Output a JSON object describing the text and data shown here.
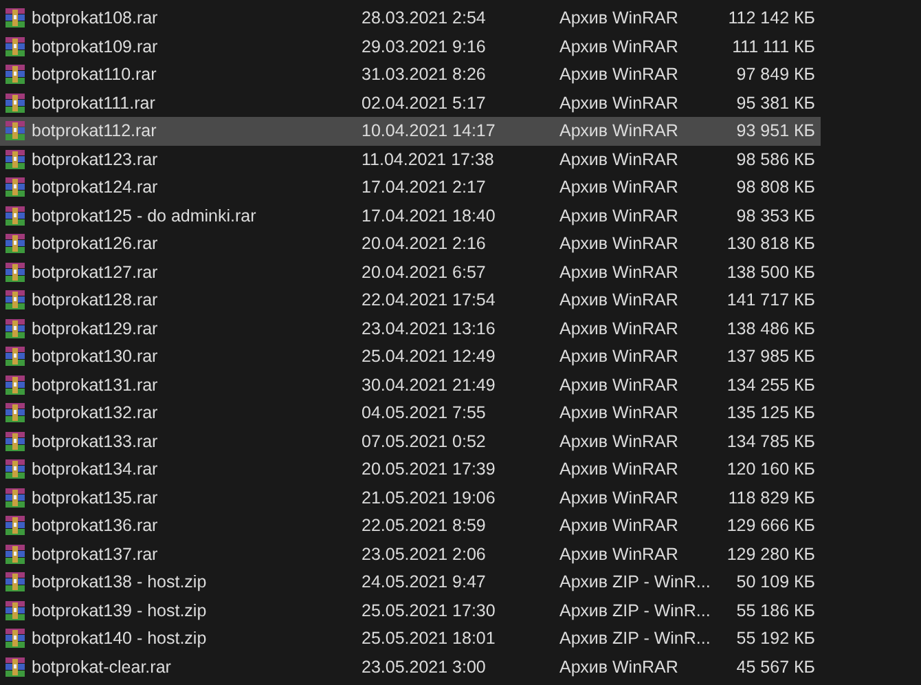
{
  "files": [
    {
      "name": "botprokat108.rar",
      "modified": "28.03.2021 2:54",
      "type": "Архив WinRAR",
      "size": "112 142 КБ",
      "selected": false
    },
    {
      "name": "botprokat109.rar",
      "modified": "29.03.2021 9:16",
      "type": "Архив WinRAR",
      "size": "111 111 КБ",
      "selected": false
    },
    {
      "name": "botprokat110.rar",
      "modified": "31.03.2021 8:26",
      "type": "Архив WinRAR",
      "size": "97 849 КБ",
      "selected": false
    },
    {
      "name": "botprokat111.rar",
      "modified": "02.04.2021 5:17",
      "type": "Архив WinRAR",
      "size": "95 381 КБ",
      "selected": false
    },
    {
      "name": "botprokat112.rar",
      "modified": "10.04.2021 14:17",
      "type": "Архив WinRAR",
      "size": "93 951 КБ",
      "selected": true
    },
    {
      "name": "botprokat123.rar",
      "modified": "11.04.2021 17:38",
      "type": "Архив WinRAR",
      "size": "98 586 КБ",
      "selected": false
    },
    {
      "name": "botprokat124.rar",
      "modified": "17.04.2021 2:17",
      "type": "Архив WinRAR",
      "size": "98 808 КБ",
      "selected": false
    },
    {
      "name": "botprokat125 - do adminki.rar",
      "modified": "17.04.2021 18:40",
      "type": "Архив WinRAR",
      "size": "98 353 КБ",
      "selected": false
    },
    {
      "name": "botprokat126.rar",
      "modified": "20.04.2021 2:16",
      "type": "Архив WinRAR",
      "size": "130 818 КБ",
      "selected": false
    },
    {
      "name": "botprokat127.rar",
      "modified": "20.04.2021 6:57",
      "type": "Архив WinRAR",
      "size": "138 500 КБ",
      "selected": false
    },
    {
      "name": "botprokat128.rar",
      "modified": "22.04.2021 17:54",
      "type": "Архив WinRAR",
      "size": "141 717 КБ",
      "selected": false
    },
    {
      "name": "botprokat129.rar",
      "modified": "23.04.2021 13:16",
      "type": "Архив WinRAR",
      "size": "138 486 КБ",
      "selected": false
    },
    {
      "name": "botprokat130.rar",
      "modified": "25.04.2021 12:49",
      "type": "Архив WinRAR",
      "size": "137 985 КБ",
      "selected": false
    },
    {
      "name": "botprokat131.rar",
      "modified": "30.04.2021 21:49",
      "type": "Архив WinRAR",
      "size": "134 255 КБ",
      "selected": false
    },
    {
      "name": "botprokat132.rar",
      "modified": "04.05.2021 7:55",
      "type": "Архив WinRAR",
      "size": "135 125 КБ",
      "selected": false
    },
    {
      "name": "botprokat133.rar",
      "modified": "07.05.2021 0:52",
      "type": "Архив WinRAR",
      "size": "134 785 КБ",
      "selected": false
    },
    {
      "name": "botprokat134.rar",
      "modified": "20.05.2021 17:39",
      "type": "Архив WinRAR",
      "size": "120 160 КБ",
      "selected": false
    },
    {
      "name": "botprokat135.rar",
      "modified": "21.05.2021 19:06",
      "type": "Архив WinRAR",
      "size": "118 829 КБ",
      "selected": false
    },
    {
      "name": "botprokat136.rar",
      "modified": "22.05.2021 8:59",
      "type": "Архив WinRAR",
      "size": "129 666 КБ",
      "selected": false
    },
    {
      "name": "botprokat137.rar",
      "modified": "23.05.2021 2:06",
      "type": "Архив WinRAR",
      "size": "129 280 КБ",
      "selected": false
    },
    {
      "name": "botprokat138 - host.zip",
      "modified": "24.05.2021 9:47",
      "type": "Архив ZIP - WinR...",
      "size": "50 109 КБ",
      "selected": false
    },
    {
      "name": "botprokat139 - host.zip",
      "modified": "25.05.2021 17:30",
      "type": "Архив ZIP - WinR...",
      "size": "55 186 КБ",
      "selected": false
    },
    {
      "name": "botprokat140 - host.zip",
      "modified": "25.05.2021 18:01",
      "type": "Архив ZIP - WinR...",
      "size": "55 192 КБ",
      "selected": false
    },
    {
      "name": "botprokat-clear.rar",
      "modified": "23.05.2021 3:00",
      "type": "Архив WinRAR",
      "size": "45 567 КБ",
      "selected": false
    }
  ]
}
